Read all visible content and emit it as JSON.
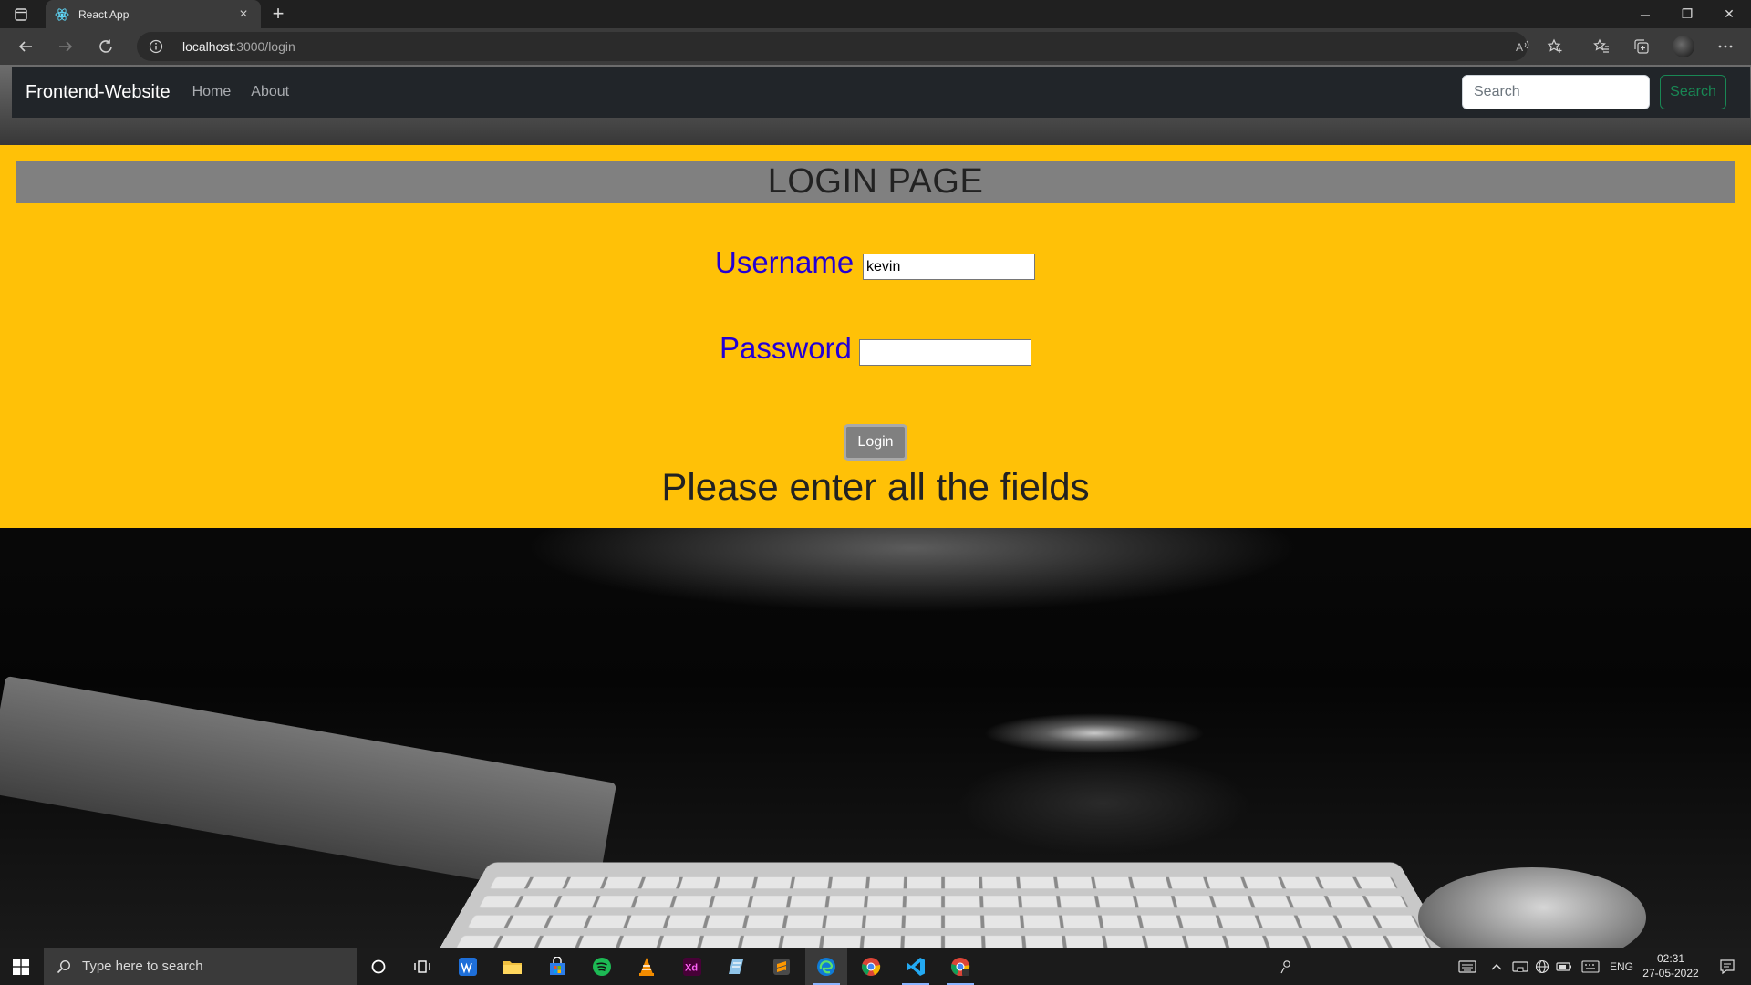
{
  "browser": {
    "tab_title": "React App",
    "tab_close": "×",
    "new_tab": "+",
    "address_host": "localhost",
    "address_path": ":3000/login",
    "window_minimize": "─",
    "window_restore": "❐",
    "window_close": "✕"
  },
  "navbar": {
    "brand": "Frontend-Website",
    "links": [
      "Home",
      "About"
    ],
    "search_placeholder": "Search",
    "search_button": "Search"
  },
  "login": {
    "title": "LOGIN PAGE",
    "username_label": "Username :",
    "username_value": "kevin",
    "password_label": "Password :",
    "password_value": "",
    "button": "Login",
    "message": "Please enter all the fields"
  },
  "taskbar": {
    "search_placeholder": "Type here to search",
    "language": "ENG",
    "time": "02:31",
    "date": "27-05-2022",
    "apps": [
      "cortana",
      "task-view",
      "writer",
      "file-explorer",
      "store",
      "spotify",
      "vlc",
      "adobe-xd",
      "notepad",
      "sublime-text",
      "edge",
      "chrome",
      "vscode",
      "chrome-dev"
    ]
  },
  "colors": {
    "panel": "#ffc107",
    "header": "#808080",
    "label": "#2300d6",
    "navbar": "#212529",
    "search_outline": "#198754"
  }
}
